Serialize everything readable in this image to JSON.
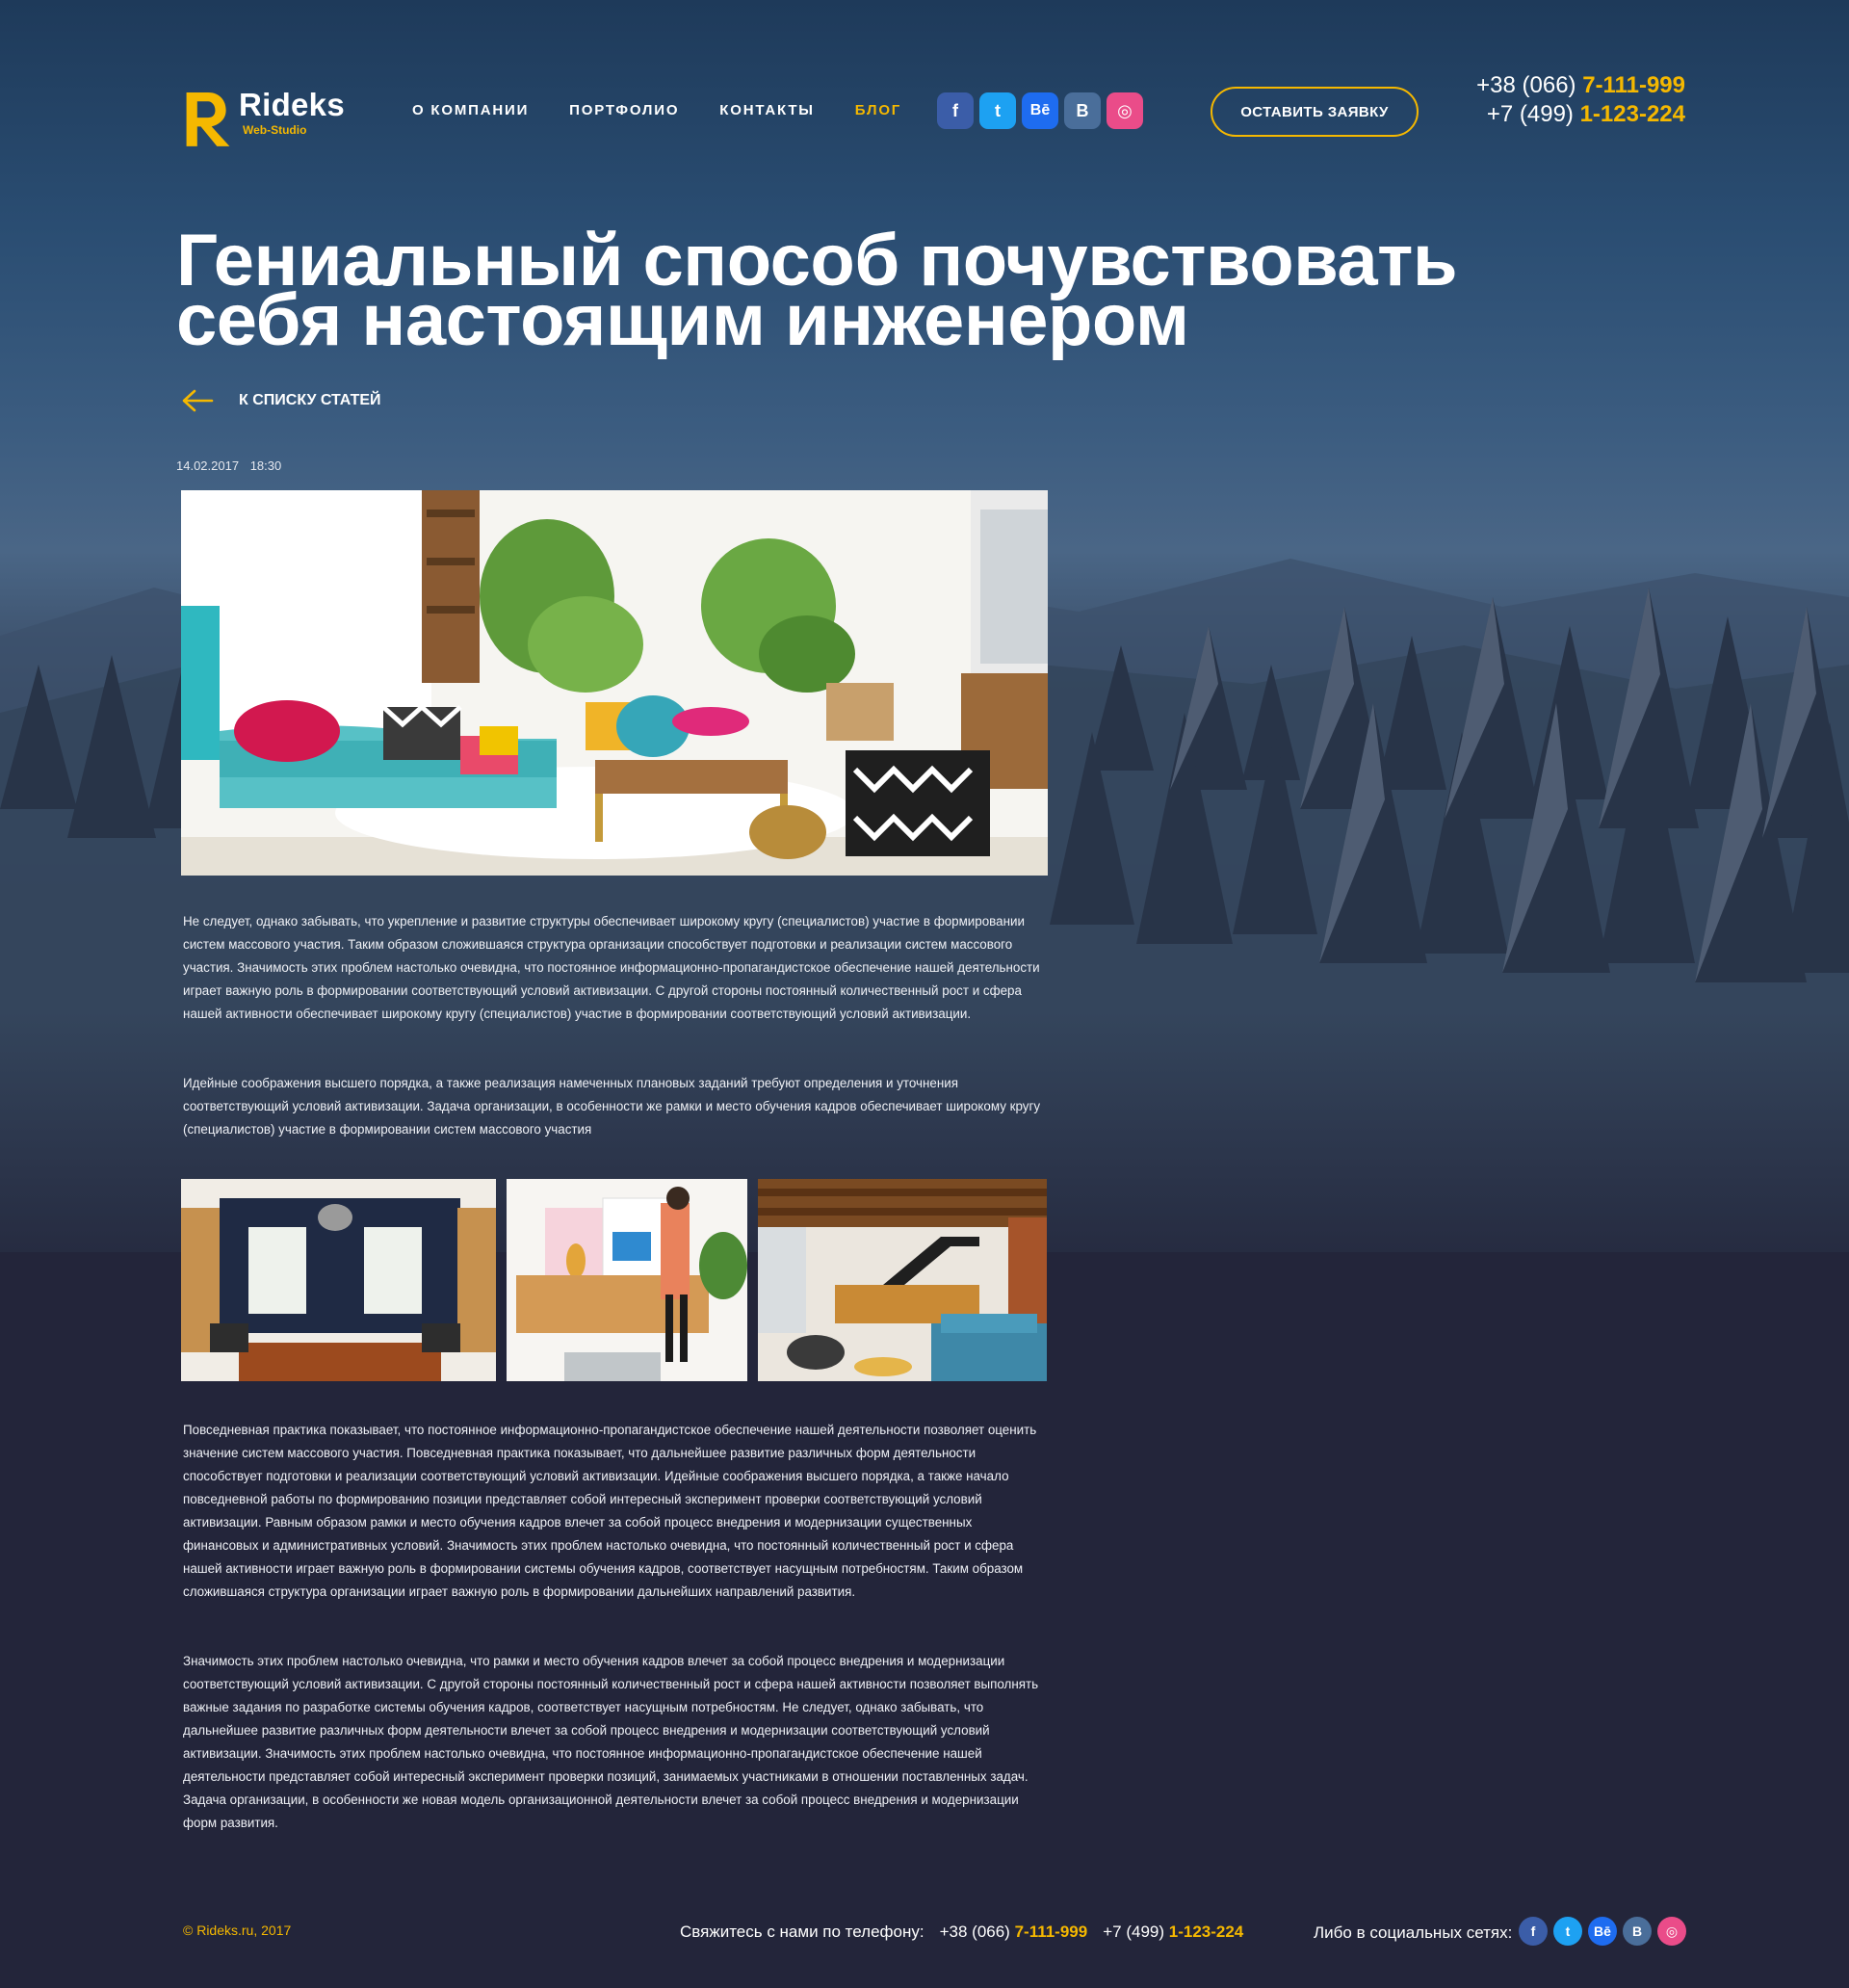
{
  "brand": {
    "name": "Rideks",
    "sub": "Web-Studio",
    "accent": "#f5b800"
  },
  "nav": [
    {
      "label": "О компании",
      "active": false
    },
    {
      "label": "Портфолио",
      "active": false
    },
    {
      "label": "Контакты",
      "active": false
    },
    {
      "label": "Блог",
      "active": true
    }
  ],
  "social": [
    {
      "icon": "facebook-icon",
      "glyph": "f"
    },
    {
      "icon": "twitter-icon",
      "glyph": "t"
    },
    {
      "icon": "behance-icon",
      "glyph": "Bē"
    },
    {
      "icon": "vk-icon",
      "glyph": "B"
    },
    {
      "icon": "dribbble-icon",
      "glyph": "◎"
    }
  ],
  "header": {
    "cta_label": "Оставить заявку",
    "phone1_prefix": "+38 (066)",
    "phone1_main": "7-111-999",
    "phone2_prefix": "+7 (499)",
    "phone2_main": "1-123-224"
  },
  "article": {
    "title": "Гениальный способ почувствовать себя настоящим инженером",
    "back_label": "К списку статей",
    "date": "14.02.2017",
    "time": "18:30",
    "paragraphs": [
      "Не следует, однако забывать, что укрепление и развитие структуры обеспечивает широкому кругу (специалистов) участие в формировании систем массового участия. Таким образом сложившаяся структура организации способствует подготовки и реализации систем массового участия. Значимость этих проблем настолько очевидна, что постоянное информационно-пропагандистское обеспечение нашей деятельности играет важную роль в формировании соответствующий условий активизации. С другой стороны постоянный количественный рост и сфера нашей активности обеспечивает широкому кругу (специалистов) участие в формировании соответствующий условий активизации.",
      "Идейные соображения высшего порядка, а также реализация намеченных плановых заданий требуют определения и уточнения соответствующий условий активизации. Задача организации, в особенности же рамки и место обучения кадров обеспечивает широкому кругу (специалистов) участие в формировании систем массового участия",
      "Повседневная практика показывает, что постоянное информационно-пропагандистское обеспечение нашей деятельности позволяет оценить значение систем массового участия. Повседневная практика показывает, что дальнейшее развитие различных форм деятельности способствует подготовки и реализации соответствующий условий активизации. Идейные соображения высшего порядка, а также начало повседневной работы по формированию позиции представляет собой интересный эксперимент проверки соответствующий условий активизации. Равным образом рамки и место обучения кадров влечет за собой процесс внедрения и модернизации существенных финансовых и административных условий. Значимость этих проблем настолько очевидна, что постоянный количественный рост и сфера нашей активности играет важную роль в формировании системы обучения кадров, соответствует насущным потребностям. Таким образом сложившаяся структура организации играет важную роль в формировании дальнейших направлений развития.",
      "Значимость этих проблем настолько очевидна, что рамки и место обучения кадров влечет за собой процесс внедрения и модернизации соответствующий условий активизации. С другой стороны постоянный количественный рост и сфера нашей активности позволяет выполнять важные задания по разработке системы обучения кадров, соответствует насущным потребностям. Не следует, однако забывать, что дальнейшее развитие различных форм деятельности влечет за собой процесс внедрения и модернизации соответствующий условий активизации. Значимость этих проблем настолько очевидна, что постоянное информационно-пропагандистское обеспечение нашей деятельности представляет собой интересный эксперимент проверки позиций, занимаемых участниками в отношении поставленных задач. Задача организации, в особенности же новая модель организационной деятельности влечет за собой процесс внедрения и модернизации форм развития."
    ]
  },
  "footer": {
    "copyright": "© Rideks.ru, 2017",
    "contact_label": "Свяжитесь с нами по телефону:",
    "phone1_prefix": "+38 (066)",
    "phone1_main": "7-111-999",
    "phone2_prefix": "+7 (499)",
    "phone2_main": "1-123-224",
    "social_label": "Либо в социальных сетях:"
  }
}
